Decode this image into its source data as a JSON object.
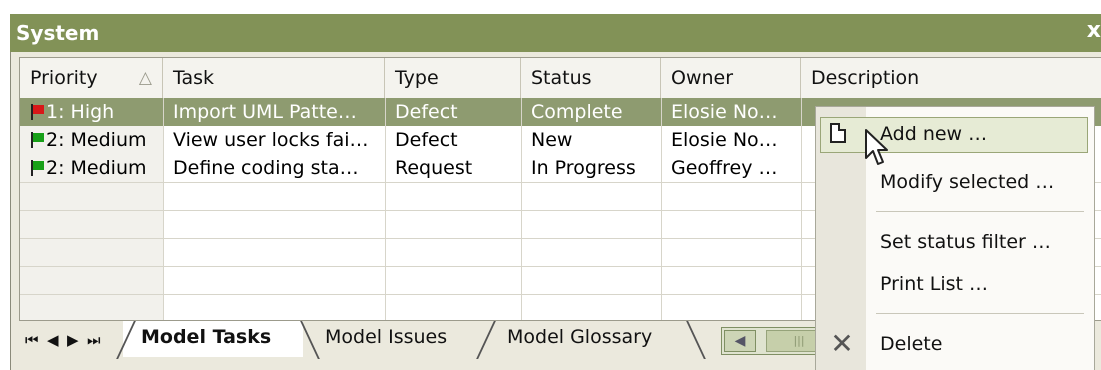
{
  "window": {
    "title": "System",
    "close_glyph": "x"
  },
  "columns": [
    {
      "label": "Priority"
    },
    {
      "label": "Task"
    },
    {
      "label": "Type"
    },
    {
      "label": "Status"
    },
    {
      "label": "Owner"
    },
    {
      "label": "Description"
    }
  ],
  "sort_indicator": "△",
  "rows": [
    {
      "priority": "1: High",
      "priority_color": "#d81818",
      "task": "Import UML Patte…",
      "type": "Defect",
      "status": "Complete",
      "owner": "Elosie No…",
      "description": "",
      "selected": true
    },
    {
      "priority": "2: Medium",
      "priority_color": "#18a018",
      "task": "View user locks fai…",
      "type": "Defect",
      "status": "New",
      "owner": "Elosie No…",
      "description": "",
      "selected": false
    },
    {
      "priority": "2: Medium",
      "priority_color": "#18a018",
      "task": "Define coding sta…",
      "type": "Request",
      "status": "In Progress",
      "owner": "Geoffrey …",
      "description": "",
      "selected": false
    }
  ],
  "tabs": {
    "nav": [
      "⏮",
      "◀",
      "▶",
      "⏭"
    ],
    "items": [
      {
        "label": "Model Tasks",
        "active": true
      },
      {
        "label": "Model Issues",
        "active": false
      },
      {
        "label": "Model Glossary",
        "active": false
      }
    ]
  },
  "context_menu": {
    "items": [
      {
        "label": "Add new …",
        "icon": "new-document-icon",
        "hover": true
      },
      {
        "label": "Modify selected …",
        "icon": "",
        "hover": false
      },
      {
        "label": "Set status filter …",
        "icon": "",
        "hover": false
      },
      {
        "label": "Print List …",
        "icon": "",
        "hover": false
      },
      {
        "label": "Delete",
        "icon": "delete-x-icon",
        "hover": false
      }
    ]
  },
  "colors": {
    "titlebar": "#829257",
    "selection": "#8e9b70",
    "menu_highlight": "#e6ebd5"
  }
}
